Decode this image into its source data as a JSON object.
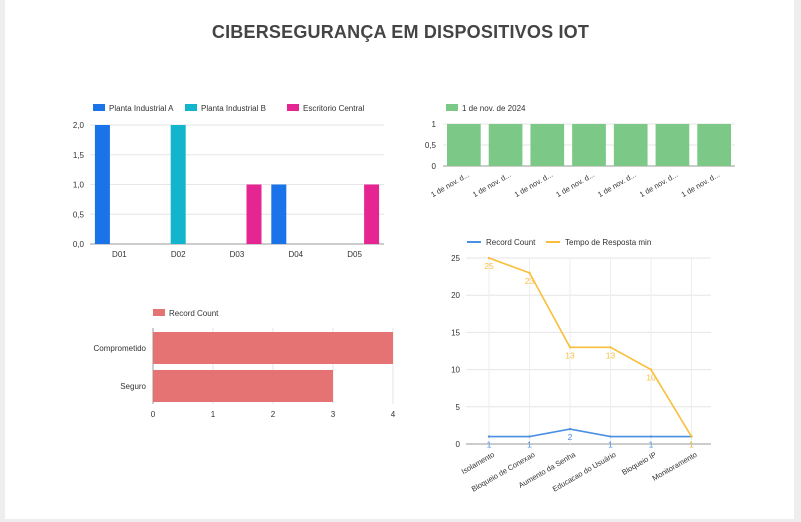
{
  "page": {
    "title": "CIBERSEGURANÇA EM DISPOSITIVOS IOT"
  },
  "chart_data": [
    {
      "id": "chart1",
      "type": "bar",
      "categories": [
        "D01",
        "D02",
        "D03",
        "D04",
        "D05"
      ],
      "series": [
        {
          "name": "Planta Industrial A",
          "color": "#1a73e8",
          "values": [
            2,
            0,
            0,
            1,
            0
          ]
        },
        {
          "name": "Planta Industrial B",
          "color": "#12b5cb",
          "values": [
            0,
            2,
            0,
            0,
            0
          ]
        },
        {
          "name": "Escritorio Central",
          "color": "#e52592",
          "values": [
            0,
            0,
            1,
            0,
            1
          ]
        }
      ],
      "ylim": [
        0,
        2
      ],
      "yticks": [
        "0,0",
        "0,5",
        "1,0",
        "1,5",
        "2,0"
      ],
      "legend": "top-left",
      "grid": true
    },
    {
      "id": "chart2",
      "type": "bar",
      "categories": [
        "1 de nov. d...",
        "1 de nov. d...",
        "1 de nov. d...",
        "1 de nov. d...",
        "1 de nov. d...",
        "1 de nov. d...",
        "1 de nov. d..."
      ],
      "series": [
        {
          "name": "1 de nov. de 2024",
          "color": "#7cc987",
          "values": [
            1,
            1,
            1,
            1,
            1,
            1,
            1
          ]
        }
      ],
      "ylim": [
        0,
        1
      ],
      "yticks": [
        "0",
        "0,5",
        "1"
      ],
      "legend": "top-left",
      "grid": true
    },
    {
      "id": "chart3",
      "type": "bar",
      "orientation": "horizontal",
      "categories": [
        "Comprometido",
        "Seguro"
      ],
      "series": [
        {
          "name": "Record Count",
          "color": "#e57373",
          "values": [
            4,
            3
          ]
        }
      ],
      "xlim": [
        0,
        4
      ],
      "xticks": [
        "0",
        "1",
        "2",
        "3",
        "4"
      ],
      "legend": "top-left",
      "grid": true
    },
    {
      "id": "chart4",
      "type": "line",
      "categories": [
        "Isolamento",
        "Bloqueio de Conexao",
        "Aumento da Senha",
        "Educacao do Usuário",
        "Bloqueio IP",
        "Monitoramento"
      ],
      "series": [
        {
          "name": "Record Count",
          "color": "#4a90e2",
          "values": [
            1,
            1,
            2,
            1,
            1,
            1
          ],
          "labels": [
            "1",
            "1",
            "2",
            "1",
            "1",
            "1"
          ]
        },
        {
          "name": "Tempo de Resposta min",
          "color": "#f9bf3b",
          "values": [
            25,
            23,
            13,
            13,
            10,
            1
          ],
          "labels": [
            "25",
            "23",
            "13",
            "13",
            "10",
            "1"
          ]
        }
      ],
      "ylim": [
        0,
        25
      ],
      "yticks": [
        "0",
        "5",
        "10",
        "15",
        "20",
        "25"
      ],
      "legend": "top-left",
      "grid": true
    }
  ]
}
